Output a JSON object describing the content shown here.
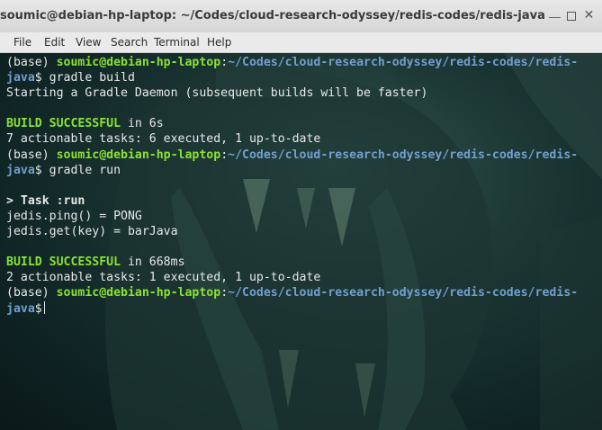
{
  "window": {
    "title": "soumic@debian-hp-laptop: ~/Codes/cloud-research-odyssey/redis-codes/redis-java"
  },
  "menu": {
    "file": "File",
    "edit": "Edit",
    "view": "View",
    "search": "Search",
    "terminal": "Terminal",
    "help": "Help"
  },
  "terminal": {
    "env": "(base) ",
    "user_host": "soumic@debian-hp-laptop",
    "colon": ":",
    "path_line1": "~/Codes/cloud-research-odyssey/redis-codes/redis-",
    "path_line2": "java",
    "dollar": "$ ",
    "cmd1": "gradle build",
    "daemon": "Starting a Gradle Daemon (subsequent builds will be faster)",
    "build_success": "BUILD SUCCESSFUL",
    "in1": " in 6s",
    "tasks1": "7 actionable tasks: 6 executed, 1 up-to-date",
    "cmd2": "gradle run",
    "task_run": "> Task :run",
    "ping": "jedis.ping() = PONG",
    "get": "jedis.get(key) = barJava",
    "in2": " in 668ms",
    "tasks2": "2 actionable tasks: 1 executed, 1 up-to-date",
    "prompt_dollar_last": "$"
  }
}
